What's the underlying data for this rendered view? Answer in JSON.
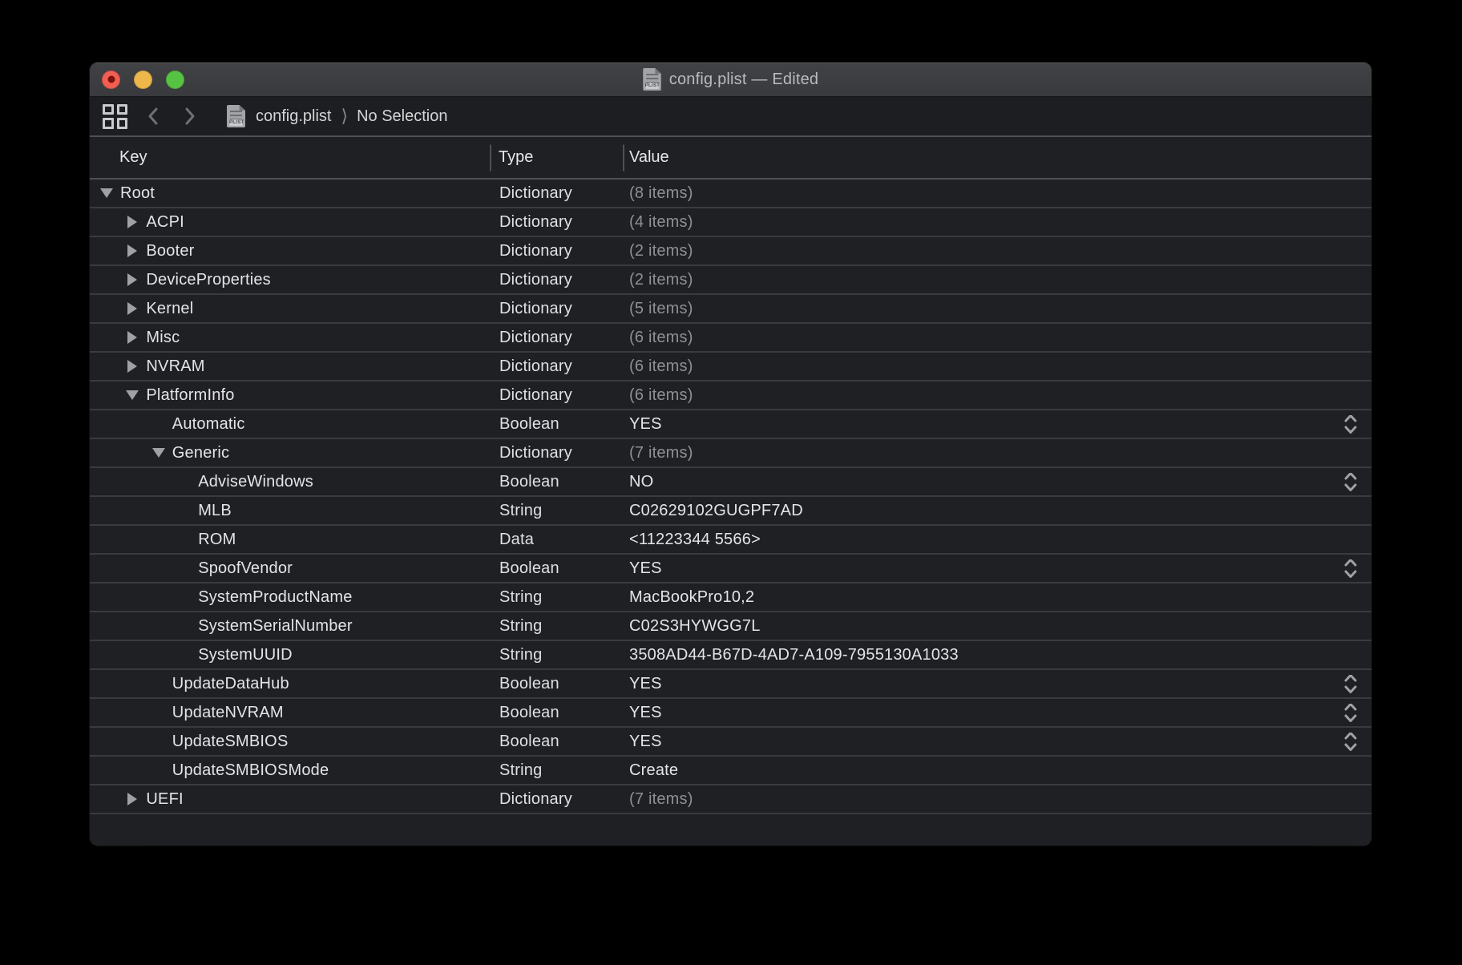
{
  "window": {
    "title": "config.plist — Edited",
    "traffic_lights": [
      {
        "name": "close",
        "color": "#f15f53",
        "edited_dot": true
      },
      {
        "name": "minimize",
        "color": "#edb74b",
        "edited_dot": false
      },
      {
        "name": "zoom",
        "color": "#57c343",
        "edited_dot": false
      }
    ]
  },
  "icons": {
    "plist_badge": "PLIST",
    "related_items": "grid-2x2",
    "back": "chevron-left",
    "forward": "chevron-right"
  },
  "jumpbar": {
    "file": "config.plist",
    "separator": "⟩",
    "selection": "No Selection"
  },
  "table": {
    "columns": [
      "Key",
      "Type",
      "Value"
    ],
    "rows": [
      {
        "key": "Root",
        "level": 0,
        "disclosure": "expanded",
        "type": "Dictionary",
        "value": "(8 items)",
        "muted": true,
        "stepper": false
      },
      {
        "key": "ACPI",
        "level": 1,
        "disclosure": "collapsed",
        "type": "Dictionary",
        "value": "(4 items)",
        "muted": true,
        "stepper": false
      },
      {
        "key": "Booter",
        "level": 1,
        "disclosure": "collapsed",
        "type": "Dictionary",
        "value": "(2 items)",
        "muted": true,
        "stepper": false
      },
      {
        "key": "DeviceProperties",
        "level": 1,
        "disclosure": "collapsed",
        "type": "Dictionary",
        "value": "(2 items)",
        "muted": true,
        "stepper": false
      },
      {
        "key": "Kernel",
        "level": 1,
        "disclosure": "collapsed",
        "type": "Dictionary",
        "value": "(5 items)",
        "muted": true,
        "stepper": false
      },
      {
        "key": "Misc",
        "level": 1,
        "disclosure": "collapsed",
        "type": "Dictionary",
        "value": "(6 items)",
        "muted": true,
        "stepper": false
      },
      {
        "key": "NVRAM",
        "level": 1,
        "disclosure": "collapsed",
        "type": "Dictionary",
        "value": "(6 items)",
        "muted": true,
        "stepper": false
      },
      {
        "key": "PlatformInfo",
        "level": 1,
        "disclosure": "expanded",
        "type": "Dictionary",
        "value": "(6 items)",
        "muted": true,
        "stepper": false
      },
      {
        "key": "Automatic",
        "level": 2,
        "disclosure": null,
        "type": "Boolean",
        "value": "YES",
        "muted": false,
        "stepper": true
      },
      {
        "key": "Generic",
        "level": 2,
        "disclosure": "expanded",
        "type": "Dictionary",
        "value": "(7 items)",
        "muted": true,
        "stepper": false
      },
      {
        "key": "AdviseWindows",
        "level": 3,
        "disclosure": null,
        "type": "Boolean",
        "value": "NO",
        "muted": false,
        "stepper": true
      },
      {
        "key": "MLB",
        "level": 3,
        "disclosure": null,
        "type": "String",
        "value": "C02629102GUGPF7AD",
        "muted": false,
        "stepper": false
      },
      {
        "key": "ROM",
        "level": 3,
        "disclosure": null,
        "type": "Data",
        "value": "<11223344 5566>",
        "muted": false,
        "stepper": false
      },
      {
        "key": "SpoofVendor",
        "level": 3,
        "disclosure": null,
        "type": "Boolean",
        "value": "YES",
        "muted": false,
        "stepper": true
      },
      {
        "key": "SystemProductName",
        "level": 3,
        "disclosure": null,
        "type": "String",
        "value": "MacBookPro10,2",
        "muted": false,
        "stepper": false
      },
      {
        "key": "SystemSerialNumber",
        "level": 3,
        "disclosure": null,
        "type": "String",
        "value": "C02S3HYWGG7L",
        "muted": false,
        "stepper": false
      },
      {
        "key": "SystemUUID",
        "level": 3,
        "disclosure": null,
        "type": "String",
        "value": "3508AD44-B67D-4AD7-A109-7955130A1033",
        "muted": false,
        "stepper": false
      },
      {
        "key": "UpdateDataHub",
        "level": 2,
        "disclosure": null,
        "type": "Boolean",
        "value": "YES",
        "muted": false,
        "stepper": true
      },
      {
        "key": "UpdateNVRAM",
        "level": 2,
        "disclosure": null,
        "type": "Boolean",
        "value": "YES",
        "muted": false,
        "stepper": true
      },
      {
        "key": "UpdateSMBIOS",
        "level": 2,
        "disclosure": null,
        "type": "Boolean",
        "value": "YES",
        "muted": false,
        "stepper": true
      },
      {
        "key": "UpdateSMBIOSMode",
        "level": 2,
        "disclosure": null,
        "type": "String",
        "value": "Create",
        "muted": false,
        "stepper": false
      },
      {
        "key": "UEFI",
        "level": 1,
        "disclosure": "collapsed",
        "type": "Dictionary",
        "value": "(7 items)",
        "muted": true,
        "stepper": false
      }
    ]
  }
}
